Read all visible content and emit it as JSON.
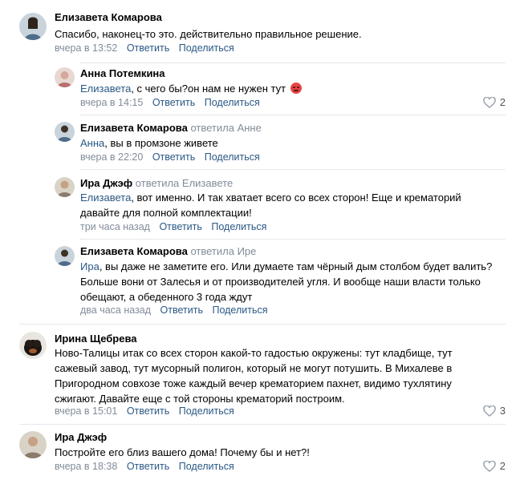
{
  "comments": [
    {
      "author": "Елизавета Комарова",
      "reply_to": "",
      "mention": "",
      "text": "Спасибо, наконец-то это. действительно правильное решение.",
      "time": "вчера в 13:52",
      "reply_label": "Ответить",
      "share_label": "Поделиться",
      "likes": ""
    },
    {
      "author": "Анна Потемкина",
      "reply_to": "",
      "mention": "Елизавета",
      "text": ", с чего бы?он нам не нужен тут",
      "time": "вчера в 14:15",
      "reply_label": "Ответить",
      "share_label": "Поделиться",
      "likes": "2"
    },
    {
      "author": "Елизавета Комарова",
      "reply_to": "ответила Анне",
      "mention": "Анна",
      "text": ", вы в промзоне живете",
      "time": "вчера в 22:20",
      "reply_label": "Ответить",
      "share_label": "Поделиться",
      "likes": ""
    },
    {
      "author": "Ира Джэф",
      "reply_to": "ответила Елизавете",
      "mention": "Елизавета",
      "text": ", вот именно. И так хватает всего со всех сторон! Еще и крематорий давайте для полной комплектации!",
      "time": "три часа назад",
      "reply_label": "Ответить",
      "share_label": "Поделиться",
      "likes": ""
    },
    {
      "author": "Елизавета Комарова",
      "reply_to": "ответила Ире",
      "mention": "Ира",
      "text": ", вы даже не заметите его. Или думаете там чёрный дым столбом будет валить? Больше вони от Залесья и от производителей угля. И вообще наши власти только обещают, а обеденного 3 года ждут",
      "time": "два часа назад",
      "reply_label": "Ответить",
      "share_label": "Поделиться",
      "likes": ""
    },
    {
      "author": "Ирина Щебрева",
      "reply_to": "",
      "mention": "",
      "text": "Ново-Талицы итак со всех сторон какой-то гадостью окружены: тут кладбище, тут сажевый завод, тут мусорный полигон, который не могут потушить. В Михалеве в Пригородном совхозе тоже каждый вечер крематорием пахнет, видимо тухлятину сжигают. Давайте еще с той стороны крематорий построим.",
      "time": "вчера в 15:01",
      "reply_label": "Ответить",
      "share_label": "Поделиться",
      "likes": "3"
    },
    {
      "author": "Ира Джэф",
      "reply_to": "",
      "mention": "",
      "text": "Постройте его близ вашего дома! Почему бы и нет?!",
      "time": "вчера в 18:38",
      "reply_label": "Ответить",
      "share_label": "Поделиться",
      "likes": "2"
    }
  ],
  "icons": {
    "like": "heart-outline-icon",
    "emoji": "angry-face-icon"
  },
  "colors": {
    "link": "#2a5885",
    "meta": "#818c99",
    "divider": "#e7e8ec",
    "heart": "#99a2ad"
  }
}
